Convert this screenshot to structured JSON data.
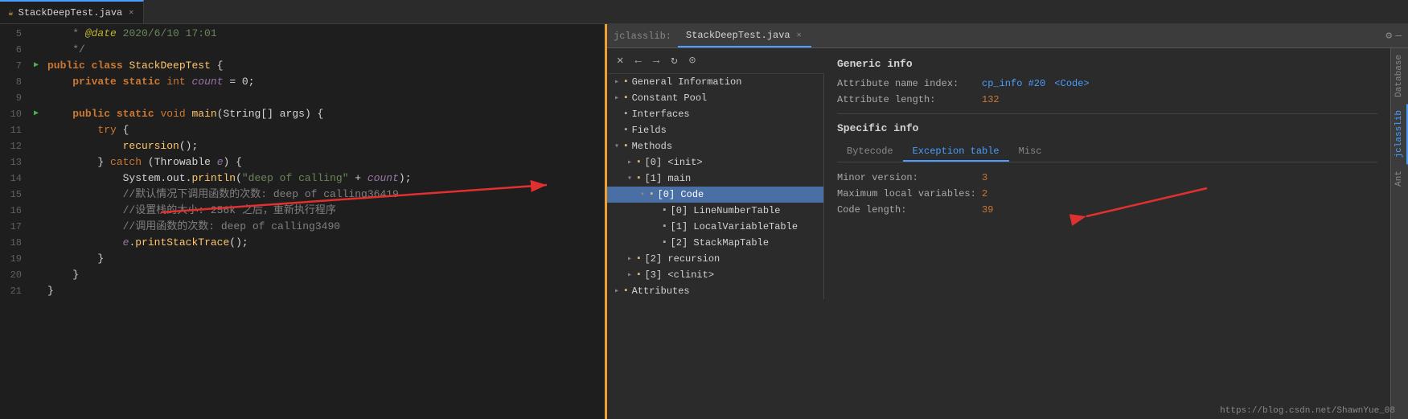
{
  "tabs": {
    "editor_tab": "StackDeepTest.java",
    "jclasslib_tab": "StackDeepTest.java",
    "jclasslib_label": "jclasslib:"
  },
  "code": {
    "lines": [
      {
        "num": 5,
        "gutter": "comment_marker",
        "content": "    * @date 2020/6/10 17:01",
        "type": "comment_date"
      },
      {
        "num": 6,
        "gutter": "",
        "content": "    */",
        "type": "comment"
      },
      {
        "num": 7,
        "gutter": "run",
        "content": "public class StackDeepTest {",
        "type": "class"
      },
      {
        "num": 8,
        "gutter": "",
        "content": "    private static int count = 0;",
        "type": "field"
      },
      {
        "num": 9,
        "gutter": "",
        "content": "",
        "type": "empty"
      },
      {
        "num": 10,
        "gutter": "run",
        "content": "    public static void main(String[] args) {",
        "type": "method"
      },
      {
        "num": 11,
        "gutter": "",
        "content": "        try {",
        "type": "code"
      },
      {
        "num": 12,
        "gutter": "",
        "content": "            recursion();",
        "type": "code"
      },
      {
        "num": 13,
        "gutter": "",
        "content": "        } catch (Throwable e) {",
        "type": "code"
      },
      {
        "num": 14,
        "gutter": "",
        "content": "            System.out.println(\"deep of calling\" + count);",
        "type": "code"
      },
      {
        "num": 15,
        "gutter": "",
        "content": "            //默认情况下调用函数的次数: deep of calling36419",
        "type": "comment_line"
      },
      {
        "num": 16,
        "gutter": "",
        "content": "            //设置栈的大小: 256k 之后，重新执行程序",
        "type": "comment_line"
      },
      {
        "num": 17,
        "gutter": "",
        "content": "            //调用函数的次数: deep of calling3490",
        "type": "comment_line"
      },
      {
        "num": 18,
        "gutter": "",
        "content": "            e.printStackTrace();",
        "type": "code"
      },
      {
        "num": 19,
        "gutter": "",
        "content": "        }",
        "type": "code"
      },
      {
        "num": 20,
        "gutter": "",
        "content": "    }",
        "type": "code"
      },
      {
        "num": 21,
        "gutter": "",
        "content": "}",
        "type": "code"
      }
    ]
  },
  "tree": {
    "items": [
      {
        "label": "General Information",
        "level": 0,
        "expanded": false,
        "type": "folder",
        "id": "general"
      },
      {
        "label": "Constant Pool",
        "level": 0,
        "expanded": false,
        "type": "folder",
        "id": "constant"
      },
      {
        "label": "Interfaces",
        "level": 0,
        "expanded": false,
        "type": "leaf",
        "id": "interfaces"
      },
      {
        "label": "Fields",
        "level": 0,
        "expanded": false,
        "type": "leaf",
        "id": "fields"
      },
      {
        "label": "Methods",
        "level": 0,
        "expanded": true,
        "type": "folder",
        "id": "methods"
      },
      {
        "label": "[0] <init>",
        "level": 1,
        "expanded": false,
        "type": "folder",
        "id": "init"
      },
      {
        "label": "[1] main",
        "level": 1,
        "expanded": true,
        "type": "folder",
        "id": "main"
      },
      {
        "label": "[0] Code",
        "level": 2,
        "expanded": true,
        "type": "folder",
        "id": "code",
        "selected": true
      },
      {
        "label": "[0] LineNumberTable",
        "level": 3,
        "expanded": false,
        "type": "leaf",
        "id": "linenumber"
      },
      {
        "label": "[1] LocalVariableTable",
        "level": 3,
        "expanded": false,
        "type": "leaf",
        "id": "localvar"
      },
      {
        "label": "[2] StackMapTable",
        "level": 3,
        "expanded": false,
        "type": "leaf",
        "id": "stackmap"
      },
      {
        "label": "[2] recursion",
        "level": 1,
        "expanded": false,
        "type": "folder",
        "id": "recursion"
      },
      {
        "label": "[3] <clinit>",
        "level": 1,
        "expanded": false,
        "type": "folder",
        "id": "clinit"
      },
      {
        "label": "Attributes",
        "level": 0,
        "expanded": false,
        "type": "folder",
        "id": "attributes"
      }
    ]
  },
  "info": {
    "generic_title": "Generic info",
    "attribute_name_label": "Attribute name index:",
    "attribute_name_value": "cp_info #20",
    "attribute_name_link": "<Code>",
    "attribute_length_label": "Attribute length:",
    "attribute_length_value": "132",
    "specific_title": "Specific info",
    "tabs": [
      "Bytecode",
      "Exception table",
      "Misc"
    ],
    "active_tab": "Misc",
    "minor_version_label": "Minor version:",
    "minor_version_value": "3",
    "max_local_label": "Maximum local variables:",
    "max_local_value": "2",
    "code_length_label": "Code length:",
    "code_length_value": "39"
  },
  "sidebar": {
    "tabs": [
      "Database",
      "jclasslib",
      "Ant"
    ]
  },
  "footer": {
    "url": "https://blog.csdn.net/ShawnYue_08"
  },
  "icons": {
    "close": "✕",
    "back": "←",
    "forward": "→",
    "refresh": "↻",
    "globe": "🌐",
    "settings": "⚙",
    "minimize": "—",
    "folder_open": "▾",
    "folder_closed": "▸",
    "run_triangle": "▶",
    "file": "▪"
  }
}
